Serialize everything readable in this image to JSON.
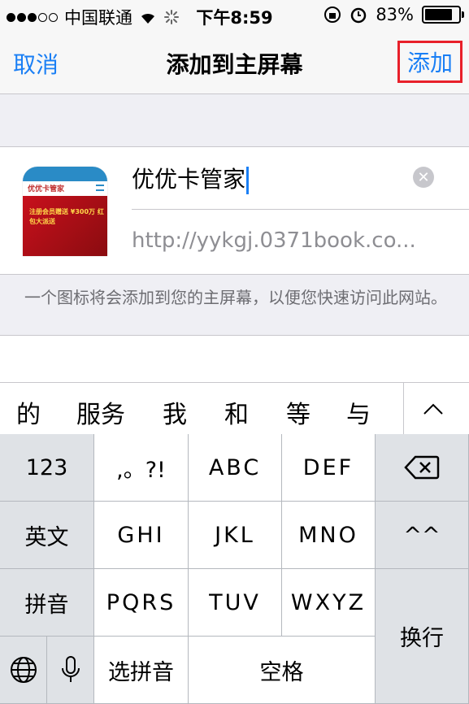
{
  "status_bar": {
    "carrier": "中国联通",
    "time": "下午8:59",
    "battery": "83%",
    "battery_level": 0.83,
    "icons": [
      "signal-dots",
      "wifi-icon",
      "loading-spinner-icon",
      "orientation-lock-icon",
      "alarm-icon",
      "battery-icon"
    ]
  },
  "nav": {
    "cancel": "取消",
    "title": "添加到主屏幕",
    "add": "添加",
    "add_highlight_color": "#e8202a",
    "accent_color": "#1a7ff5"
  },
  "form": {
    "thumbnail_logo": "优优卡管家",
    "thumbnail_banner": "注册会员赠送 ¥300万 红包大派送",
    "title_value": "优优卡管家",
    "url_value": "http://yykgj.0371book.co..."
  },
  "hint": "一个图标将会添加到您的主屏幕，以便您快速访问此网站。",
  "candidates": [
    "的",
    "服务",
    "我",
    "和",
    "等",
    "与"
  ],
  "keyboard": {
    "rows": [
      [
        "123",
        ",。?!",
        "ABC",
        "DEF",
        "delete"
      ],
      [
        "英文",
        "GHI",
        "JKL",
        "MNO",
        "^^"
      ],
      [
        "拼音",
        "PQRS",
        "TUV",
        "WXYZ",
        "换行"
      ],
      [
        "globe",
        "mic",
        "选拼音",
        "空格"
      ]
    ],
    "num": "123",
    "punct": ",。?!",
    "abc": "ABC",
    "def": "DEF",
    "english": "英文",
    "ghi": "GHI",
    "jkl": "JKL",
    "mno": "MNO",
    "emoticon": "^^",
    "pinyin": "拼音",
    "pqrs": "PQRS",
    "tuv": "TUV",
    "wxyz": "WXYZ",
    "newline": "换行",
    "select_pinyin": "选拼音",
    "space": "空格"
  }
}
